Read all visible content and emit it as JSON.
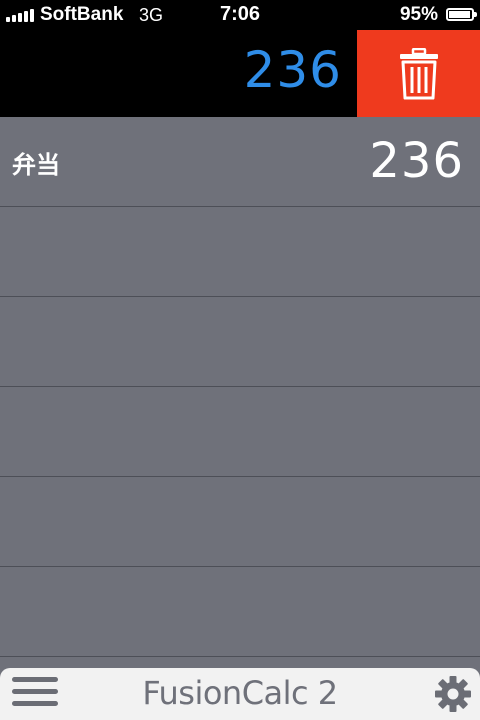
{
  "status_bar": {
    "carrier": "SoftBank",
    "network": "3G",
    "time": "7:06",
    "battery_percent": "95%",
    "battery_level": 0.95,
    "signal_bars": 5
  },
  "display": {
    "value": "236",
    "value_color": "#2f8de8",
    "delete_icon": "trash-icon",
    "delete_color": "#ef3a1e"
  },
  "rows": [
    {
      "label": "弁当",
      "value": "236"
    },
    {
      "label": "",
      "value": ""
    },
    {
      "label": "",
      "value": ""
    },
    {
      "label": "",
      "value": ""
    },
    {
      "label": "",
      "value": ""
    },
    {
      "label": "",
      "value": ""
    }
  ],
  "bottom_bar": {
    "menu_icon": "hamburger-menu-icon",
    "title": "FusionCalc 2",
    "settings_icon": "gear-icon"
  }
}
